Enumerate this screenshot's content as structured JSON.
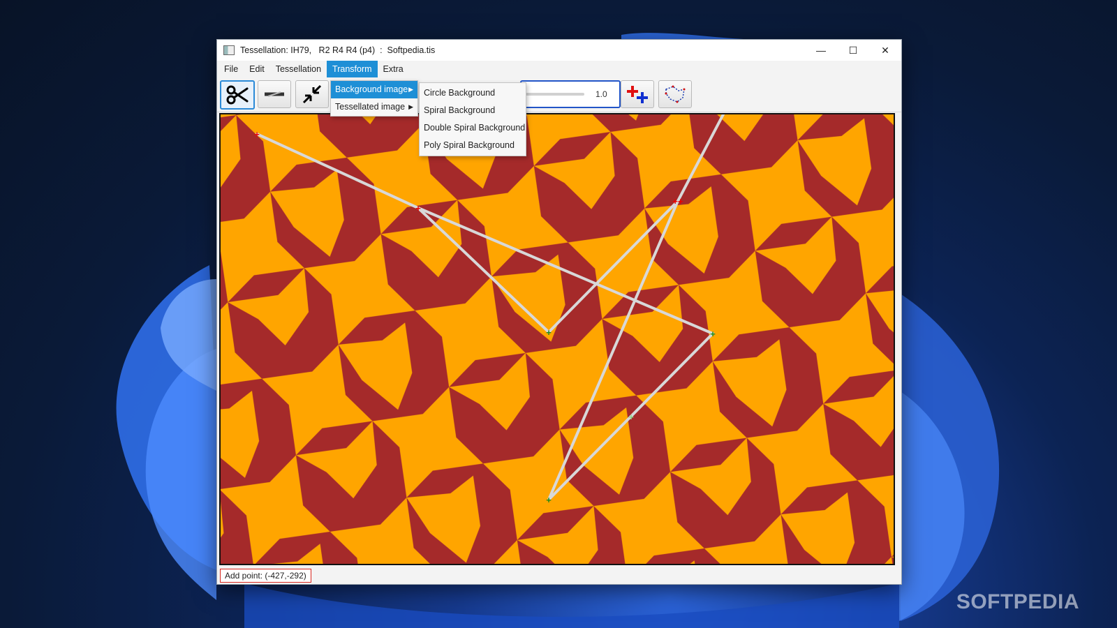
{
  "window": {
    "title": "Tessellation: IH79,   R2 R4 R4 (p4)  :  Softpedia.tis",
    "controls": {
      "minimize": "—",
      "maximize": "☐",
      "close": "✕"
    }
  },
  "menubar": {
    "items": [
      {
        "label": "File"
      },
      {
        "label": "Edit"
      },
      {
        "label": "Tessellation"
      },
      {
        "label": "Transform"
      },
      {
        "label": "Extra"
      }
    ]
  },
  "transform_menu": {
    "items": [
      {
        "label": "Background image"
      },
      {
        "label": "Tessellated image"
      }
    ]
  },
  "background_submenu": {
    "items": [
      {
        "label": "Circle Background"
      },
      {
        "label": "Spiral Background"
      },
      {
        "label": "Double Spiral Background"
      },
      {
        "label": "Poly Spiral Background"
      }
    ]
  },
  "toolbar": {
    "tools": [
      {
        "icon": "scissors-icon"
      },
      {
        "icon": "move-icon"
      },
      {
        "icon": "shrink-icon"
      },
      {
        "icon": "add-point-icon"
      },
      {
        "icon": "shape-outline-icon"
      }
    ],
    "zoom_value": "1.0"
  },
  "status": {
    "text": "Add point: (-427,-292)"
  },
  "watermark": "SOFTPEDIA",
  "colors": {
    "tile_primary": "#a52a2a",
    "tile_secondary": "#ffa500",
    "accent": "#1e8fd6",
    "highlight_border": "#2255c8"
  }
}
